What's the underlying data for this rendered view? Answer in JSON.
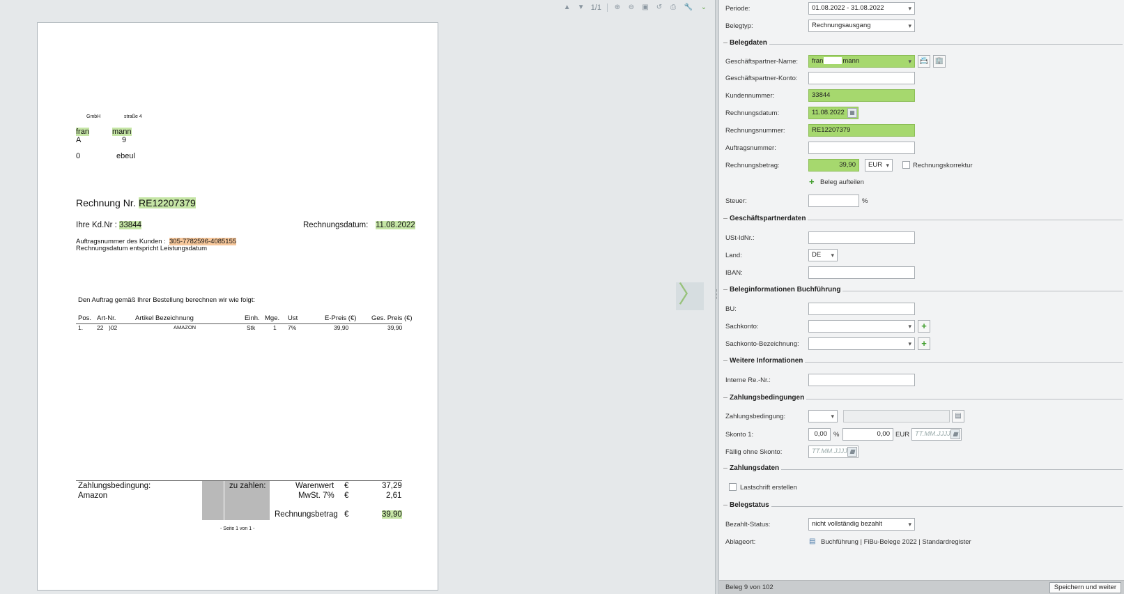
{
  "viewer": {
    "page_indicator": "1/1",
    "next_arrow": "〉"
  },
  "invoice": {
    "sender_gmbh": "GmbH",
    "sender_street": "straße 4",
    "recipient_name_a": "fran",
    "recipient_name_b": "mann",
    "recipient_line2_a": "A",
    "recipient_line2_b": "9",
    "recipient_line3_a": "0",
    "recipient_line3_b": "ebeul",
    "title_prefix": "Rechnung Nr.",
    "invoice_number": "RE12207379",
    "kdnr_label": "Ihre Kd.Nr :",
    "kdnr_value": "33844",
    "date_label": "Rechnungsdatum:",
    "date_value": "11.08.2022",
    "order_label": "Auftragsnummer des Kunden :",
    "order_value": "305-7782596-4085155",
    "leistung_note": "Rechnungsdatum entspricht Leistungsdatum",
    "intro_text": "Den Auftrag gemäß Ihrer Bestellung berechnen wir wie folgt:",
    "table_headers": [
      "Pos.",
      "Art-Nr.",
      "Artikel Bezeichnung",
      "Einh.",
      "Mge.",
      "Ust",
      "E-Preis (€)",
      "Ges. Preis (€)"
    ],
    "table_row": [
      "1.",
      "22",
      ")02",
      "AMAZON",
      "Stk",
      "1",
      "7%",
      "39,90",
      "39,90"
    ],
    "payment_label": "Zahlungsbedingung:",
    "payment_value": "Amazon",
    "to_pay_label": "zu zahlen:",
    "warenwert_label": "Warenwert",
    "warenwert_cur": "€",
    "warenwert_value": "37,29",
    "mwst_label": "MwSt. 7%",
    "mwst_cur": "€",
    "mwst_value": "2,61",
    "betrag_label": "Rechnungsbetrag",
    "betrag_cur": "€",
    "betrag_value": "39,90",
    "page_footer": "- Seite 1 von 1 -"
  },
  "form": {
    "periode_label": "Periode:",
    "periode_value": "01.08.2022 - 31.08.2022",
    "belegtyp_label": "Belegtyp:",
    "belegtyp_value": "Rechnungsausgang",
    "section_belegdaten": "Belegdaten",
    "gp_name_label": "Geschäftspartner-Name:",
    "gp_name_value_a": "fran",
    "gp_name_value_b": "mann",
    "gp_konto_label": "Geschäftspartner-Konto:",
    "gp_konto_value": "",
    "kundennummer_label": "Kundennummer:",
    "kundennummer_value": "33844",
    "rechnungsdatum_label": "Rechnungsdatum:",
    "rechnungsdatum_value": "11.08.2022",
    "rechnungsnummer_label": "Rechnungsnummer:",
    "rechnungsnummer_value": "RE12207379",
    "auftragsnummer_label": "Auftragsnummer:",
    "auftragsnummer_value": "",
    "rechnungsbetrag_label": "Rechnungsbetrag:",
    "rechnungsbetrag_value": "39,90",
    "currency_value": "EUR",
    "korrektur_label": "Rechnungskorrektur",
    "beleg_aufteilen": "Beleg aufteilen",
    "steuer_label": "Steuer:",
    "steuer_unit": "%",
    "section_gpdaten": "Geschäftspartnerdaten",
    "ustid_label": "USt-IdNr.:",
    "land_label": "Land:",
    "land_value": "DE",
    "iban_label": "IBAN:",
    "section_buchfuehrung": "Beleginformationen Buchführung",
    "bu_label": "BU:",
    "sachkonto_label": "Sachkonto:",
    "sachkonto_bez_label": "Sachkonto-Bezeichnung:",
    "section_weitere": "Weitere Informationen",
    "interne_re_label": "Interne Re.-Nr.:",
    "section_zahlungsbed": "Zahlungsbedingungen",
    "zahlungsbed_label": "Zahlungsbedingung:",
    "skonto_label": "Skonto 1:",
    "skonto_pct_value": "0,00",
    "skonto_pct_unit": "%",
    "skonto_amount_value": "0,00",
    "skonto_amount_unit": "EUR",
    "skonto_date_placeholder": "TT.MM.JJJJ",
    "faellig_label": "Fällig ohne Skonto:",
    "faellig_placeholder": "TT.MM.JJJJ",
    "section_zahlungsdaten": "Zahlungsdaten",
    "lastschrift_label": "Lastschrift erstellen",
    "section_belegstatus": "Belegstatus",
    "bezahlt_label": "Bezahlt-Status:",
    "bezahlt_value": "nicht vollständig bezahlt",
    "ablageort_label": "Ablageort:",
    "ablageort_value": "Buchführung | FiBu-Belege 2022 | Standardregister"
  },
  "status": {
    "beleg_counter": "Beleg 9 von 102",
    "save_button": "Speichern und weiter"
  },
  "colors": {
    "highlight_green": "#a6d86e",
    "doc_highlight_green": "#c6e6a6",
    "doc_highlight_orange": "#f6c79b",
    "plus_green": "#3f9d2b"
  },
  "icons": [
    "arrow-up-icon",
    "arrow-down-icon",
    "zoom-in-icon",
    "zoom-out-icon",
    "fit-page-icon",
    "rotate-icon",
    "pdf-icon",
    "wrench-icon",
    "chevron-down-icon",
    "address-book-icon",
    "building-icon",
    "calendar-icon",
    "plus-icon",
    "folder-icon"
  ]
}
